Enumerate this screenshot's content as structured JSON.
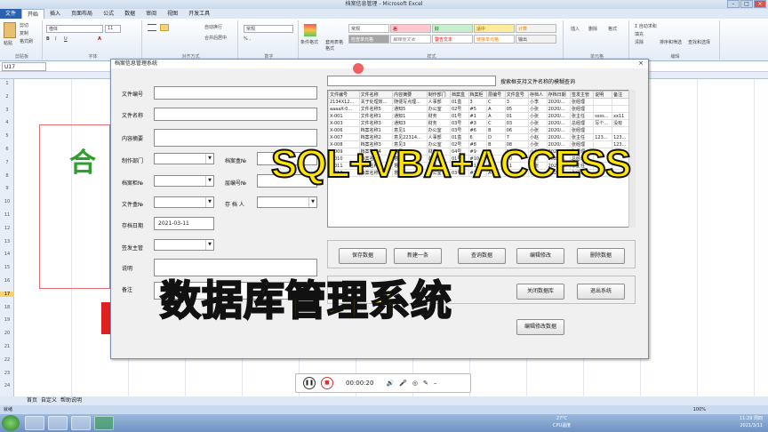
{
  "window": {
    "title": "档案信息管理 - Microsoft Excel"
  },
  "tabs": [
    "文件",
    "开始",
    "插入",
    "页面布局",
    "公式",
    "数据",
    "审阅",
    "视图",
    "开发工具"
  ],
  "ribbon": {
    "paste": "粘贴",
    "cut": "剪切",
    "copy": "复制",
    "format_painter": "格式刷",
    "font_name": "楷体",
    "font_size": "11",
    "wrap": "自动换行",
    "merge": "合并后居中",
    "number_format": "常规",
    "cond_format": "条件格式",
    "table_format": "套用表格格式",
    "styles": [
      "常规",
      "差",
      "好",
      "适中",
      "计算",
      "检查单元格",
      "解释性文本",
      "警告文本",
      "链接单元格",
      "输出"
    ],
    "insert": "插入",
    "delete": "删除",
    "format": "格式",
    "autosum": "自动求和",
    "fill": "填充",
    "clear": "清除",
    "sort": "排序和筛选",
    "find": "查找和选择",
    "group_labels": [
      "剪贴板",
      "字体",
      "对齐方式",
      "数字",
      "样式",
      "单元格",
      "编辑"
    ]
  },
  "formula": {
    "namebox": "U17"
  },
  "rows": [
    "1",
    "2",
    "3",
    "4",
    "5",
    "6",
    "7",
    "8",
    "9",
    "10",
    "11",
    "12",
    "13",
    "14",
    "15",
    "16",
    "17",
    "18",
    "19",
    "20",
    "21",
    "22",
    "23",
    "24"
  ],
  "selected_row": "17",
  "sheet_bg_text": "合",
  "sheet_tabs": [
    "首页",
    "自定义",
    "帮助说明"
  ],
  "status": {
    "ready": "就绪",
    "zoom": "100%"
  },
  "tray": {
    "temp": "27°C",
    "cpu": "CPU温度",
    "time": "11:29 周四",
    "date": "2021/3/11"
  },
  "dialog": {
    "title": "档案信息管理系统",
    "close": "×",
    "labels": {
      "file_no": "文件编号",
      "file_name": "文件名称",
      "summary": "内容摘要",
      "dept": "制作部门",
      "archive_box": "档案盒№",
      "cabinet": "档案柜№",
      "layer": "层编号№",
      "folder": "文件盒№",
      "keeper": "存 档 人",
      "date": "存档日期",
      "signer": "签发主管",
      "desc": "说明",
      "remark": "备注"
    },
    "date_value": "2021-03-11",
    "search_hint": "搜索框支持文件名称的模糊查询",
    "buttons": {
      "save": "保存数据",
      "new": "新建一条",
      "query": "查询数据",
      "edit": "编辑修改",
      "delete": "删除数据",
      "close_db": "关闭数据库",
      "exit": "退出系统",
      "edit2": "编辑修改数据"
    },
    "grid": {
      "headers": [
        "文件编号",
        "文件名称",
        "内容摘要",
        "制作部门",
        "档案盒",
        "档案柜",
        "层编号",
        "文件盒号",
        "存档人",
        "存档日期",
        "签发主管",
        "说明",
        "备注"
      ],
      "rows": [
        [
          "2134X12...",
          "关于处理效...",
          "随便写点理...",
          "人事部",
          "01盒",
          "3",
          "C",
          "3",
          "小李",
          "2020/...",
          "张经理",
          "",
          ""
        ],
        [
          "aaaaX-0...",
          "文件名称5",
          "通知5",
          "办公室",
          "02号",
          "#5",
          "A",
          "05",
          "小张",
          "2020/...",
          "张经理",
          "",
          ""
        ],
        [
          "X-001",
          "文件名称1",
          "通知1",
          "财务",
          "01号",
          "#1",
          "A",
          "01",
          "小张",
          "2020/...",
          "张主任",
          "ssss...",
          "xx11"
        ],
        [
          "X-003",
          "文件名称3",
          "通知3",
          "财务",
          "03号",
          "#3",
          "C",
          "03",
          "小张",
          "2020/...",
          "总经理",
          "写个...",
          "没有"
        ],
        [
          "X-006",
          "档案名称1",
          "意见1",
          "办公室",
          "03号",
          "#6",
          "B",
          "06",
          "小张",
          "2020/...",
          "张经理",
          "",
          ""
        ],
        [
          "X-007",
          "档案名称2",
          "意见22314...",
          "人事部",
          "01盒",
          "6",
          "D",
          "7",
          "小赵",
          "2020/...",
          "张主任",
          "123...",
          "123..."
        ],
        [
          "X-008",
          "档案名称3",
          "意见3",
          "办公室",
          "02号",
          "#8",
          "B",
          "08",
          "小张",
          "2020/...",
          "张经理",
          "",
          "123..."
        ],
        [
          "X-009",
          "档案名称4",
          "意见457...",
          "财务",
          "04号",
          "#9",
          "D",
          "09",
          "小张",
          "2020/...",
          "张经理",
          "",
          ""
        ],
        [
          "X-010",
          "档案名称5",
          "意见5",
          "办公室",
          "01号",
          "#10",
          "C",
          "10",
          "小张",
          "2020/...",
          "总经理",
          "",
          ""
        ],
        [
          "X-011",
          "档案名称6",
          "意见6",
          "财务",
          "02号",
          "#11",
          "D",
          "11",
          "小张",
          "2020/...",
          "李主任",
          "",
          ""
        ],
        [
          "X-012",
          "档案名称7",
          "意见7",
          "办公室",
          "03号",
          "#12",
          "A",
          "12",
          "小张",
          "2020/...",
          "张经理",
          "",
          ""
        ]
      ]
    }
  },
  "overlay": {
    "line1": "SQL+VBA+ACCESS",
    "line2": "数据库管理系统"
  },
  "recorder": {
    "time": "00:00:20"
  },
  "colors": {
    "overlay_text": "#ffe600",
    "accent": "#2a62b0",
    "green": "#2e9e2e"
  }
}
